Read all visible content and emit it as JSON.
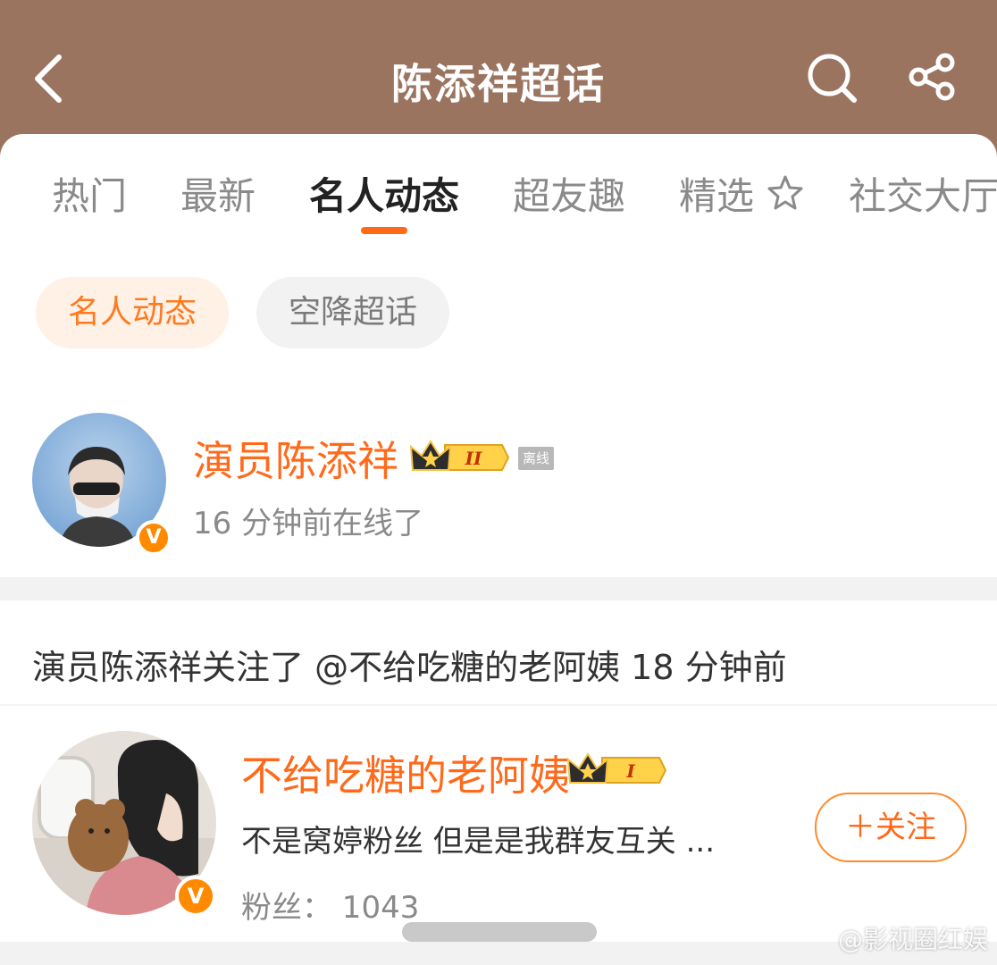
{
  "header": {
    "title": "陈添祥超话",
    "back_icon": "back-chevron-icon",
    "search_icon": "search-icon",
    "share_icon": "share-icon"
  },
  "tabs": [
    {
      "label": "热门"
    },
    {
      "label": "最新"
    },
    {
      "label": "名人动态",
      "active": true
    },
    {
      "label": "超友趣"
    },
    {
      "label": "精选"
    },
    {
      "label": "社交大厅"
    }
  ],
  "chips": {
    "selected": "名人动态",
    "other": "空降超话"
  },
  "celebrity": {
    "name": "演员陈添祥",
    "level_badge": "II",
    "status_badge": "离线",
    "last_online": "16 分钟前在线了"
  },
  "activity": {
    "text": "演员陈添祥关注了 @不给吃糖的老阿姨 18 分钟前"
  },
  "followed_user": {
    "name": "不给吃糖的老阿姨",
    "level_badge": "I",
    "bio": "不是窝婷粉丝 但是是我群友互关 ...",
    "fans": "粉丝：  1043",
    "follow_button": "＋关注"
  },
  "watermark": "@影视圈红娱",
  "colors": {
    "header_bg": "#9b7460",
    "accent": "#ff6a1a",
    "verified": "#ff8a00"
  }
}
